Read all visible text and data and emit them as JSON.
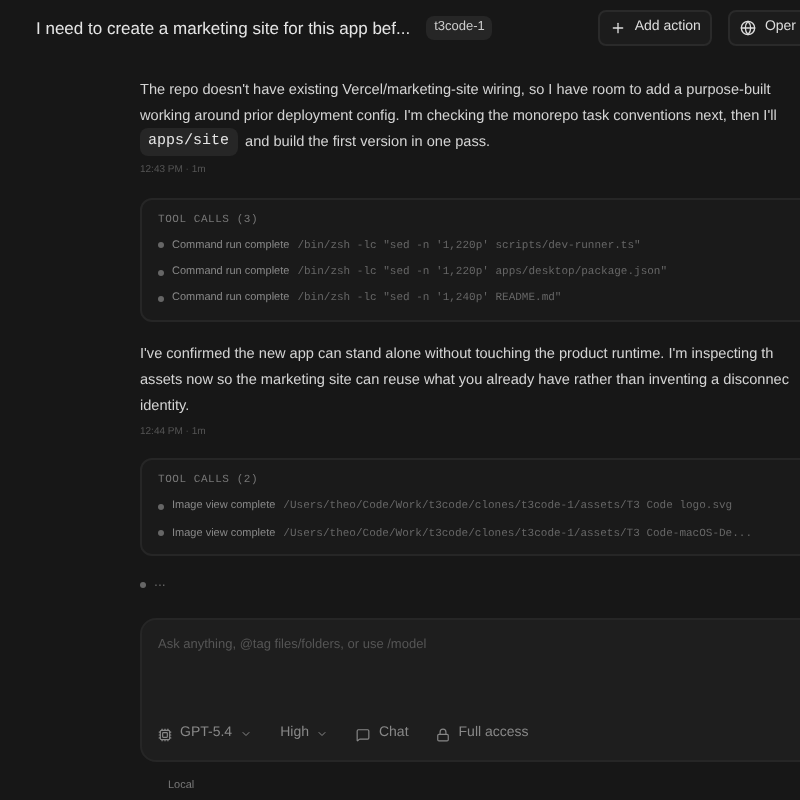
{
  "header": {
    "title": "I need to create a marketing site for this app bef...",
    "badge": "t3code-1",
    "actions": [
      {
        "label": "Add action",
        "kind": "add"
      },
      {
        "label": "Oper",
        "kind": "open"
      }
    ]
  },
  "messages": [
    {
      "kind": "text",
      "lines": [
        "The repo doesn't have existing Vercel/marketing-site wiring, so I have room to add a purpose-built",
        "working around prior deployment config. I'm checking the monorepo task conventions next, then I'll"
      ],
      "code": "apps/site",
      "tail": "and build the first version in one pass.",
      "time": "12:43 PM · 1m"
    },
    {
      "kind": "tools",
      "title": "TOOL CALLS (3)",
      "items": [
        {
          "status": "Command run complete",
          "detail": "/bin/zsh -lc \"sed -n '1,220p' scripts/dev-runner.ts\""
        },
        {
          "status": "Command run complete",
          "detail": "/bin/zsh -lc \"sed -n '1,220p' apps/desktop/package.json\""
        },
        {
          "status": "Command run complete",
          "detail": "/bin/zsh -lc \"sed -n '1,240p' README.md\""
        }
      ]
    },
    {
      "kind": "text",
      "lines": [
        "I've confirmed the new app can stand alone without touching the product runtime. I'm inspecting th",
        "assets now so the marketing site can reuse what you already have rather than inventing a disconnec",
        "identity."
      ],
      "time": "12:44 PM · 1m"
    },
    {
      "kind": "tools",
      "title": "TOOL CALLS (2)",
      "items": [
        {
          "status": "Image view complete",
          "detail": "/Users/theo/Code/Work/t3code/clones/t3code-1/assets/T3 Code logo.svg"
        },
        {
          "status": "Image view complete",
          "detail": "/Users/theo/Code/Work/t3code/clones/t3code-1/assets/T3 Code-macOS-De..."
        }
      ]
    },
    {
      "kind": "working",
      "text": "..."
    }
  ],
  "composer": {
    "placeholder": "Ask anything, @tag files/folders, or use /model",
    "controls": [
      {
        "label": "GPT-5.4",
        "kind": "model"
      },
      {
        "label": "High",
        "kind": "effort"
      },
      {
        "label": "Chat",
        "kind": "chat"
      },
      {
        "label": "Full access",
        "kind": "access"
      }
    ]
  },
  "footer": "Local"
}
